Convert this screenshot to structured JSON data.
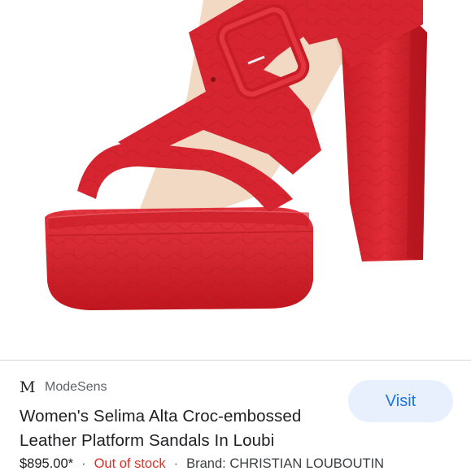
{
  "image": {
    "alt": "",
    "colors": {
      "leather": "#d62530",
      "leather_dark": "#a9141c",
      "insole": "#f1d9c4"
    }
  },
  "source": {
    "logo_letter": "M",
    "name": "ModeSens"
  },
  "visit_button": {
    "label": "Visit",
    "bg_color": "#e8f0fe",
    "text_color": "#1a73e8"
  },
  "product": {
    "title": "Women's Selima Alta Croc-embossed Leather Platform Sandals In Loubi",
    "price": "$895.00*",
    "separator": "·",
    "stock_status": "Out of stock",
    "stock_color": "#d93025",
    "brand": "Brand: CHRISTIAN LOUBOUTIN"
  }
}
